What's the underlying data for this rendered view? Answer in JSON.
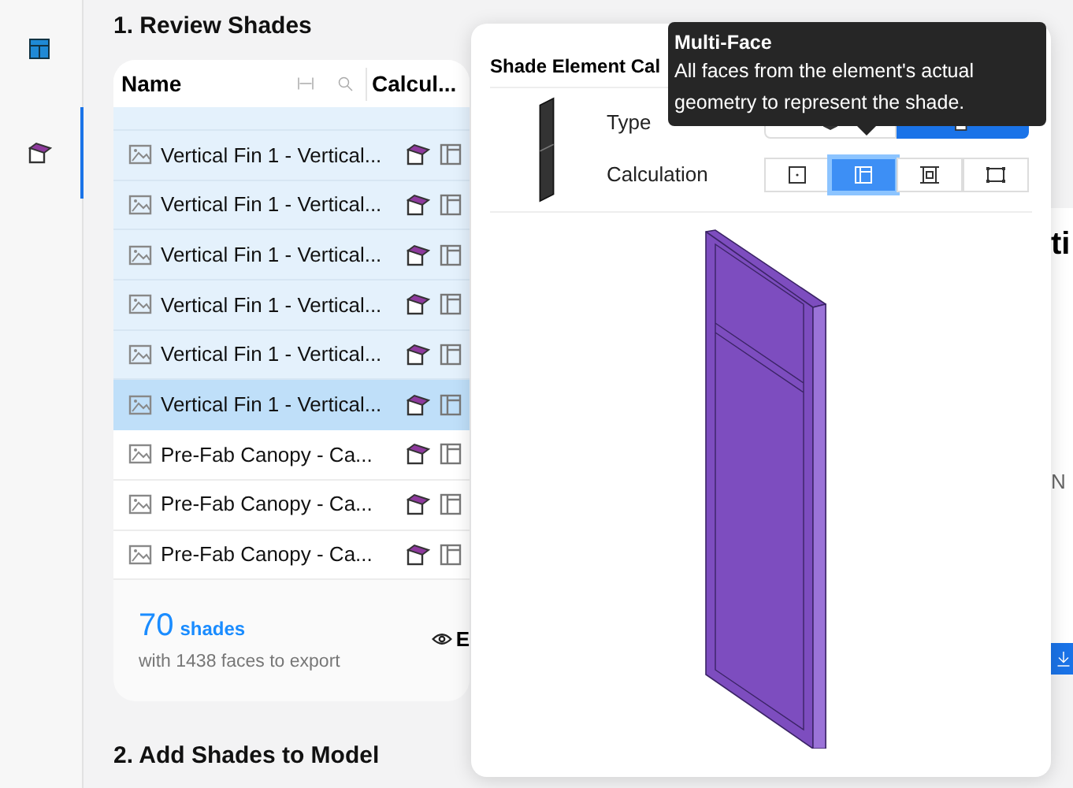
{
  "sidebar": {
    "items": [
      {
        "kind": "table",
        "selected": false
      },
      {
        "kind": "shade",
        "selected": true
      }
    ]
  },
  "review": {
    "title": "1. Review Shades",
    "columns": [
      "Name",
      "Calcul..."
    ],
    "rows": [
      {
        "name": "Vertical Fin 1 - Vertical...",
        "selected": true,
        "active": false
      },
      {
        "name": "Vertical Fin 1 - Vertical...",
        "selected": true,
        "active": false
      },
      {
        "name": "Vertical Fin 1 - Vertical...",
        "selected": true,
        "active": false
      },
      {
        "name": "Vertical Fin 1 - Vertical...",
        "selected": true,
        "active": false
      },
      {
        "name": "Vertical Fin 1 - Vertical...",
        "selected": true,
        "active": false
      },
      {
        "name": "Vertical Fin 1 - Vertical...",
        "selected": true,
        "active": true
      },
      {
        "name": "Pre-Fab Canopy - Ca...",
        "selected": false,
        "active": false
      },
      {
        "name": "Pre-Fab Canopy - Ca...",
        "selected": false,
        "active": false
      },
      {
        "name": "Pre-Fab Canopy - Ca...",
        "selected": false,
        "active": false
      }
    ],
    "count": "70",
    "count_unit": "shades",
    "summary": "with 1438 faces to export",
    "preview_button": "E"
  },
  "add_title": "2. Add Shades to Model",
  "background_texts": [
    "ti",
    "N"
  ],
  "popover": {
    "title": "Shade Element Cal",
    "type_label": "Type",
    "calc_label": "Calculation",
    "type_options": [
      {
        "kind": "solid",
        "selected": false
      },
      {
        "kind": "shade",
        "selected": true
      }
    ],
    "calc_options": [
      {
        "kind": "center",
        "selected": false
      },
      {
        "kind": "multi",
        "selected": true
      },
      {
        "kind": "stack",
        "selected": false
      },
      {
        "kind": "frame",
        "selected": false
      }
    ]
  },
  "tooltip": {
    "title": "Multi-Face",
    "text": "All faces from the element's actual geometry to represent the shade."
  }
}
